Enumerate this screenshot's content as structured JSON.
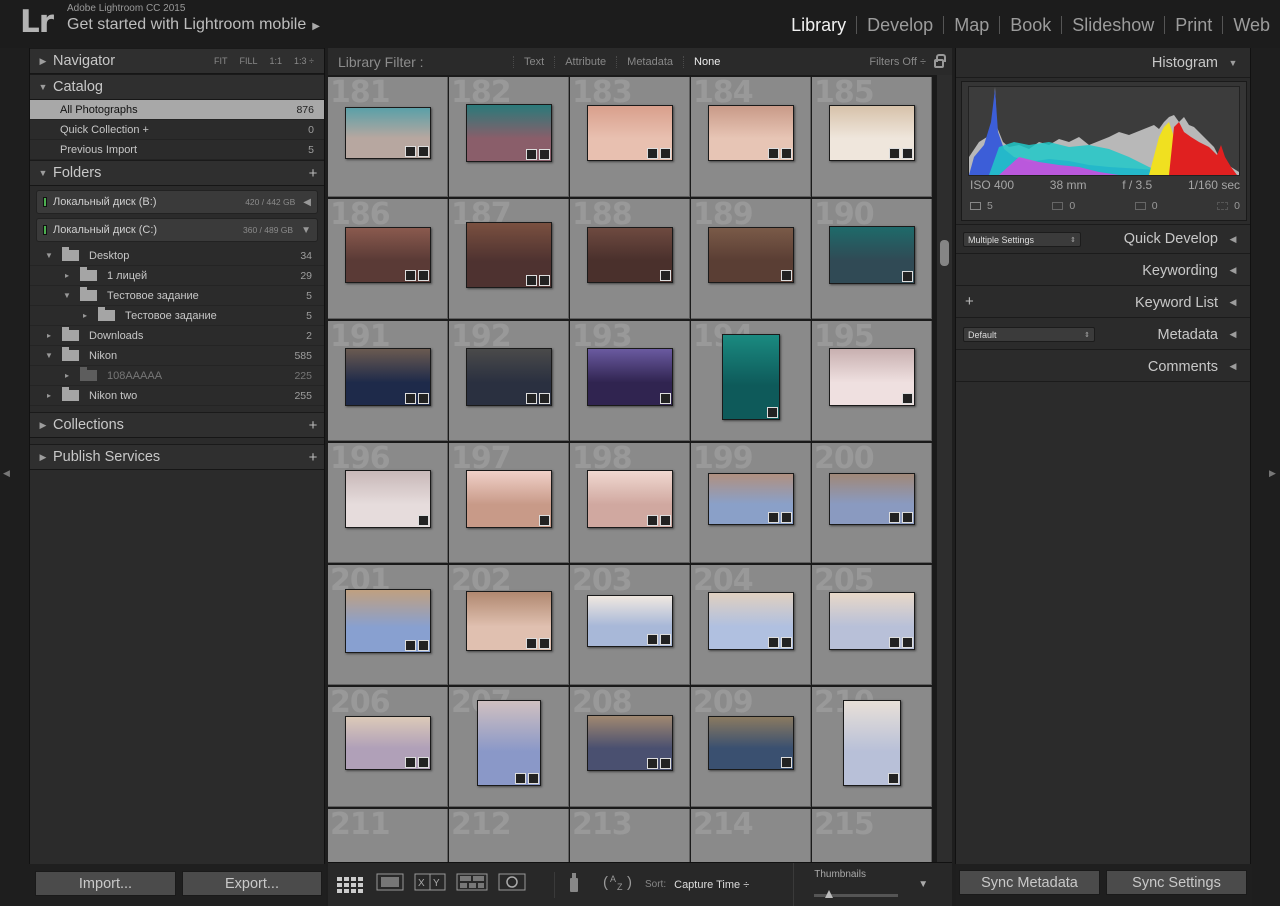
{
  "app": {
    "logo": "Lr",
    "product_name": "Adobe Lightroom CC 2015",
    "identity_plate": "Get started with Lightroom mobile",
    "modules": [
      "Library",
      "Develop",
      "Map",
      "Book",
      "Slideshow",
      "Print",
      "Web"
    ],
    "active_module": "Library"
  },
  "left_panel": {
    "navigator": {
      "title": "Navigator",
      "options": [
        "FIT",
        "FILL",
        "1:1",
        "1:3 ÷"
      ]
    },
    "catalog": {
      "title": "Catalog",
      "items": [
        {
          "label": "All Photographs",
          "count": "876"
        },
        {
          "label": "Quick Collection +",
          "count": "0"
        },
        {
          "label": "Previous Import",
          "count": "5"
        }
      ]
    },
    "folders": {
      "title": "Folders",
      "volumes": [
        {
          "name": "Локальный диск (B:)",
          "size": "420 / 442 GB"
        },
        {
          "name": "Локальный диск (C:)",
          "size": "360 / 489 GB"
        }
      ],
      "tree": [
        {
          "label": "Desktop",
          "count": "34"
        },
        {
          "label": "1 лицей",
          "count": "29"
        },
        {
          "label": "Тестовое задание",
          "count": "5"
        },
        {
          "label": "Тестовое задание",
          "count": "5"
        },
        {
          "label": "Downloads",
          "count": "2"
        },
        {
          "label": "Nikon",
          "count": "585"
        },
        {
          "label": "108AAAAA",
          "count": "225"
        },
        {
          "label": "Nikon two",
          "count": "255"
        }
      ]
    },
    "collections": {
      "title": "Collections"
    },
    "publish": {
      "title": "Publish Services"
    },
    "import_button": "Import...",
    "export_button": "Export..."
  },
  "filter_bar": {
    "label": "Library Filter :",
    "options": [
      "Text",
      "Attribute",
      "Metadata",
      "None"
    ],
    "active": "None",
    "filters_off": "Filters Off ÷"
  },
  "grid": {
    "indices": [
      "181",
      "182",
      "183",
      "184",
      "185",
      "186",
      "187",
      "188",
      "189",
      "190",
      "191",
      "192",
      "193",
      "194",
      "195",
      "196",
      "197",
      "198",
      "199",
      "200",
      "201",
      "202",
      "203",
      "204",
      "205",
      "206",
      "207",
      "208",
      "209",
      "210",
      "211",
      "212",
      "213",
      "214",
      "215"
    ]
  },
  "toolbar": {
    "sort_label": "Sort:",
    "sort_value": "Capture Time ÷",
    "thumbnails_label": "Thumbnails"
  },
  "right_panel": {
    "histogram": {
      "title": "Histogram",
      "iso": "ISO 400",
      "focal": "38 mm",
      "aperture": "f / 3.5",
      "shutter": "1/160 sec",
      "icon_values": [
        "5",
        "0",
        "0",
        "0"
      ]
    },
    "quick_develop": {
      "title": "Quick Develop",
      "preset": "Multiple Settings"
    },
    "keywording": {
      "title": "Keywording"
    },
    "keyword_list": {
      "title": "Keyword List"
    },
    "metadata": {
      "title": "Metadata",
      "preset": "Default"
    },
    "comments": {
      "title": "Comments"
    },
    "sync_metadata": "Sync Metadata",
    "sync_settings": "Sync Settings"
  }
}
